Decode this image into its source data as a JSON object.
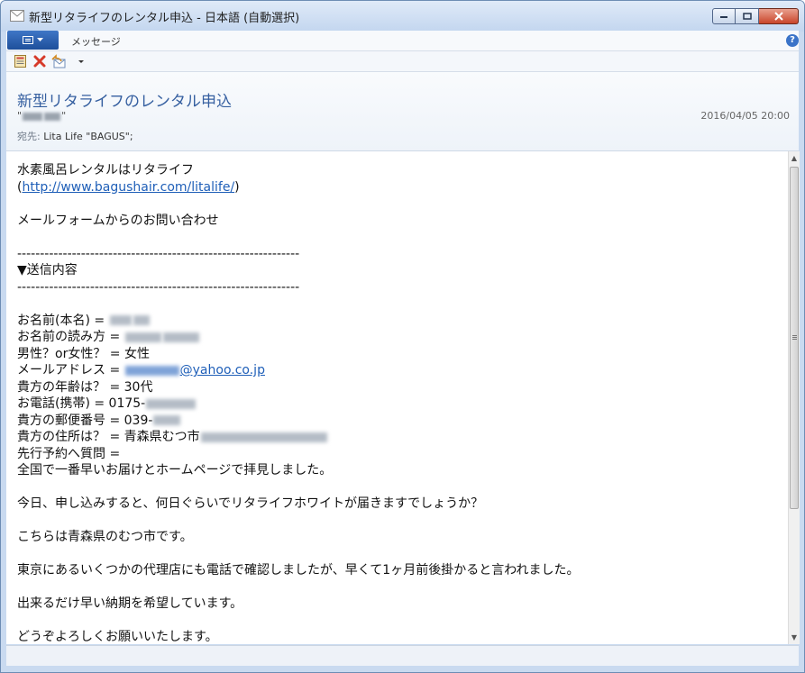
{
  "window": {
    "title": "新型リタライフのレンタル申込 - 日本語 (自動選択)"
  },
  "menubar": {
    "tab_label": "メッセージ",
    "help_symbol": "?"
  },
  "toolbar": {
    "icons": [
      "save-icon",
      "delete-icon",
      "reply-icon",
      "dropdown-arrow-icon"
    ]
  },
  "header": {
    "subject": "新型リタライフのレンタル申込",
    "date": "2016/04/05 20:00",
    "to_label": "宛先:",
    "to_value": "Lita Life \"BAGUS\";"
  },
  "body": {
    "line1": "水素風呂レンタルはリタライフ",
    "url": "http://www.bagushair.com/litalife/",
    "line3": "メールフォームからのお問い合わせ",
    "separator": "--------------------------------------------------------------",
    "section": "▼送信内容",
    "name_label": "お名前(本名) = ",
    "reading_label": "お名前の読み方 = ",
    "gender": "男性？or女性？ = 女性",
    "email_label": "メールアドレス = ",
    "email_domain": "@yahoo.co.jp",
    "age": "貴方の年齢は？ = 30代",
    "phone_label": "お電話(携帯) = 0175-",
    "zip_label": "貴方の郵便番号 = 039-",
    "address_label": "貴方の住所は？ = 青森県むつ市",
    "question_label": "先行予約へ質問 = ",
    "q1": "全国で一番早いお届けとホームページで拝見しました。",
    "q2": "今日、申し込みすると、何日ぐらいでリタライフホワイトが届きますでしょうか？",
    "q3": "こちらは青森県のむつ市です。",
    "q4": "東京にあるいくつかの代理店にも電話で確認しましたが、早くて1ヶ月前後掛かると言われました。",
    "q5": "出来るだけ早い納期を希望しています。",
    "q6": "どうぞよろしくお願いいたします。"
  },
  "colors": {
    "subject": "#355fa0",
    "link": "#1f5fb8",
    "accent": "#1e4f9b"
  }
}
